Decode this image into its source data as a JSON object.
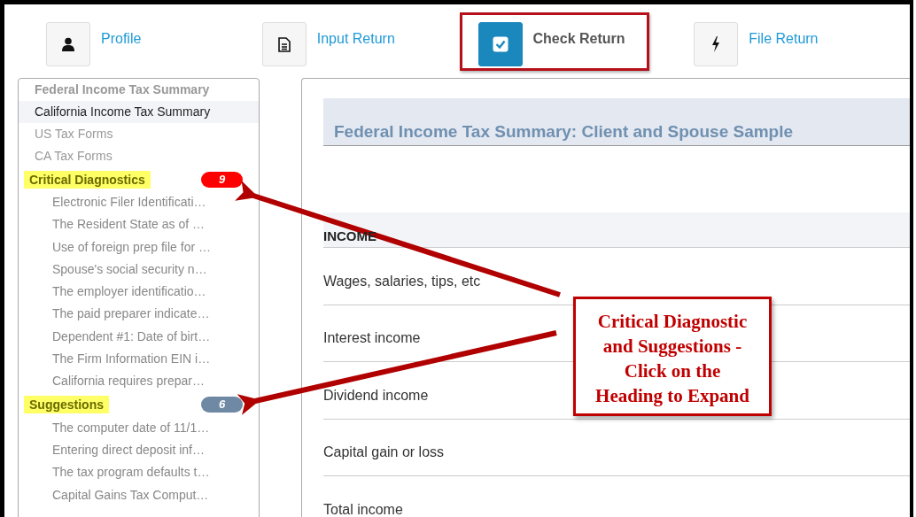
{
  "tabs": [
    {
      "label": "Profile",
      "selected": false,
      "highlighted": false
    },
    {
      "label": "Input Return",
      "selected": false,
      "highlighted": false
    },
    {
      "label": "Check Return",
      "selected": true,
      "highlighted": true
    },
    {
      "label": "File Return",
      "selected": false,
      "highlighted": false
    }
  ],
  "sidebar": {
    "items": [
      {
        "kind": "link",
        "label": "Federal Income Tax Summary",
        "selected": true,
        "hovered": false
      },
      {
        "kind": "link",
        "label": "California Income Tax Summary",
        "selected": false,
        "hovered": true
      },
      {
        "kind": "link",
        "label": "US Tax Forms",
        "selected": false,
        "hovered": false
      },
      {
        "kind": "link",
        "label": "CA Tax Forms",
        "selected": false,
        "hovered": false
      },
      {
        "kind": "section",
        "label": "Critical Diagnostics",
        "count": "9",
        "color": "#ff0000",
        "highlighted": true,
        "children": [
          "Electronic Filer Identificati…",
          "The Resident State as of …",
          "Use of foreign prep file for …",
          "Spouse's social security n…",
          "The employer identificatio…",
          "The paid preparer indicate…",
          "Dependent #1: Date of birt…",
          "The Firm Information EIN i…",
          "California requires prepar…"
        ]
      },
      {
        "kind": "section",
        "label": "Suggestions",
        "count": "6",
        "color": "#6f88a3",
        "highlighted": true,
        "children": [
          "The computer date of 11/1…",
          "Entering direct deposit inf…",
          "The tax program defaults t…",
          "Capital Gains Tax Comput…"
        ]
      }
    ]
  },
  "main": {
    "title": "Federal Income Tax Summary: Client and Spouse Sample",
    "section": "INCOME",
    "rows": [
      "Wages, salaries, tips, etc",
      "Interest income",
      "Dividend income",
      "Capital gain or loss",
      "Total income"
    ]
  },
  "callout": {
    "text": "Critical Diagnostic\nand Suggestions -\nClick on the\nHeading to Expand"
  }
}
